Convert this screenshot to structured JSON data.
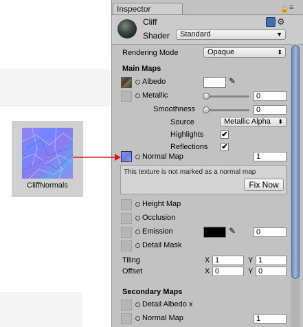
{
  "asset": {
    "name": "CliffNormals"
  },
  "inspector": {
    "tab": "Inspector",
    "material_name": "Cliff",
    "shader_label": "Shader",
    "shader_value": "Standard"
  },
  "rendering_mode": {
    "label": "Rendering Mode",
    "value": "Opaque"
  },
  "main_maps": {
    "heading": "Main Maps",
    "albedo": {
      "label": "Albedo",
      "color": "#ffffff"
    },
    "metallic": {
      "label": "Metallic",
      "value": "0",
      "level": 0
    },
    "smoothness": {
      "label": "Smoothness",
      "value": "0",
      "level": 0
    },
    "source": {
      "label": "Source",
      "value": "Metallic Alpha"
    },
    "highlights": {
      "label": "Highlights",
      "checked": true
    },
    "reflections": {
      "label": "Reflections",
      "checked": true
    },
    "normal_map": {
      "label": "Normal Map",
      "value": "1"
    },
    "help_text": "This texture is not marked as a normal map",
    "fix_label": "Fix Now",
    "height_map": {
      "label": "Height Map"
    },
    "occlusion": {
      "label": "Occlusion"
    },
    "emission": {
      "label": "Emission",
      "color": "#000000",
      "value": "0"
    },
    "detail_mask": {
      "label": "Detail Mask"
    },
    "tiling": {
      "label": "Tiling",
      "x_label": "X",
      "x": "1",
      "y_label": "Y",
      "y": "1"
    },
    "offset": {
      "label": "Offset",
      "x_label": "X",
      "x": "0",
      "y_label": "Y",
      "y": "0"
    }
  },
  "secondary_maps": {
    "heading": "Secondary Maps",
    "detail_albedo": {
      "label": "Detail Albedo x"
    },
    "normal_map": {
      "label": "Normal Map",
      "value": "1"
    }
  },
  "check_mark": "✔",
  "colors": {
    "arrow": "#e01010",
    "scrollbar": "#8aa2d2"
  }
}
